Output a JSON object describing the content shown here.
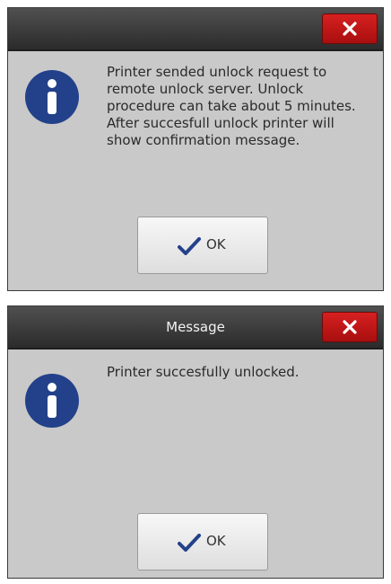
{
  "dialog1": {
    "title": "",
    "message": "Printer sended unlock request to\nremote unlock server. Unlock\nprocedure can take about 5 minutes.\nAfter succesfull unlock printer will\nshow confirmation message.",
    "ok_label": "OK",
    "icons": {
      "close": "close-icon",
      "info": "info-icon",
      "ok": "check-icon"
    }
  },
  "dialog2": {
    "title": "Message",
    "message": "Printer succesfully unlocked.",
    "ok_label": "OK",
    "icons": {
      "close": "close-icon",
      "info": "info-icon",
      "ok": "check-icon"
    }
  },
  "colors": {
    "titlebar": "#2b2b2b",
    "close_button": "#c41818",
    "dialog_body": "#c9c9c9",
    "info_icon": "#23418a",
    "check_icon": "#23418a"
  }
}
